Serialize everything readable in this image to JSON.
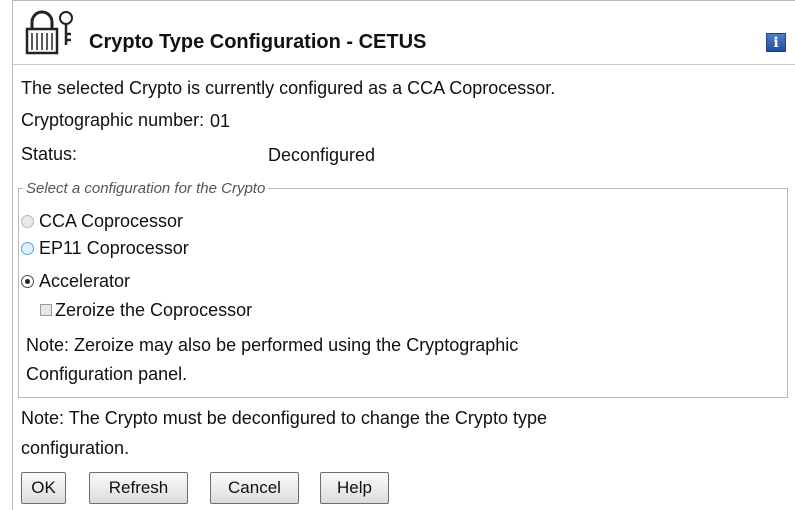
{
  "dialog": {
    "title": "Crypto Type Configuration - CETUS",
    "info_icon": "i"
  },
  "info": {
    "current_config": "The selected Crypto is currently configured as a CCA Coprocessor.",
    "crypto_number_label": "Cryptographic number:",
    "crypto_number_value": "01",
    "status_label": "Status:",
    "status_value": "Deconfigured"
  },
  "group": {
    "legend": "Select a configuration for the Crypto",
    "options": [
      {
        "label": "CCA Coprocessor",
        "selected": false,
        "enabled": false
      },
      {
        "label": "EP11 Coprocessor",
        "selected": false,
        "enabled": true
      },
      {
        "label": "Accelerator",
        "selected": true,
        "enabled": true
      }
    ],
    "zeroize_label": "Zeroize the Coprocessor",
    "zeroize_checked": false,
    "note_line1": "Note: Zeroize may also be performed using the Cryptographic",
    "note_line2": "Configuration panel."
  },
  "footer_note": {
    "line1": "Note: The Crypto must be deconfigured to change the Crypto type",
    "line2": "configuration."
  },
  "buttons": {
    "ok": "OK",
    "refresh": "Refresh",
    "cancel": "Cancel",
    "help": "Help"
  },
  "icons": {
    "title": "lock-key-icon",
    "info": "info-icon"
  }
}
